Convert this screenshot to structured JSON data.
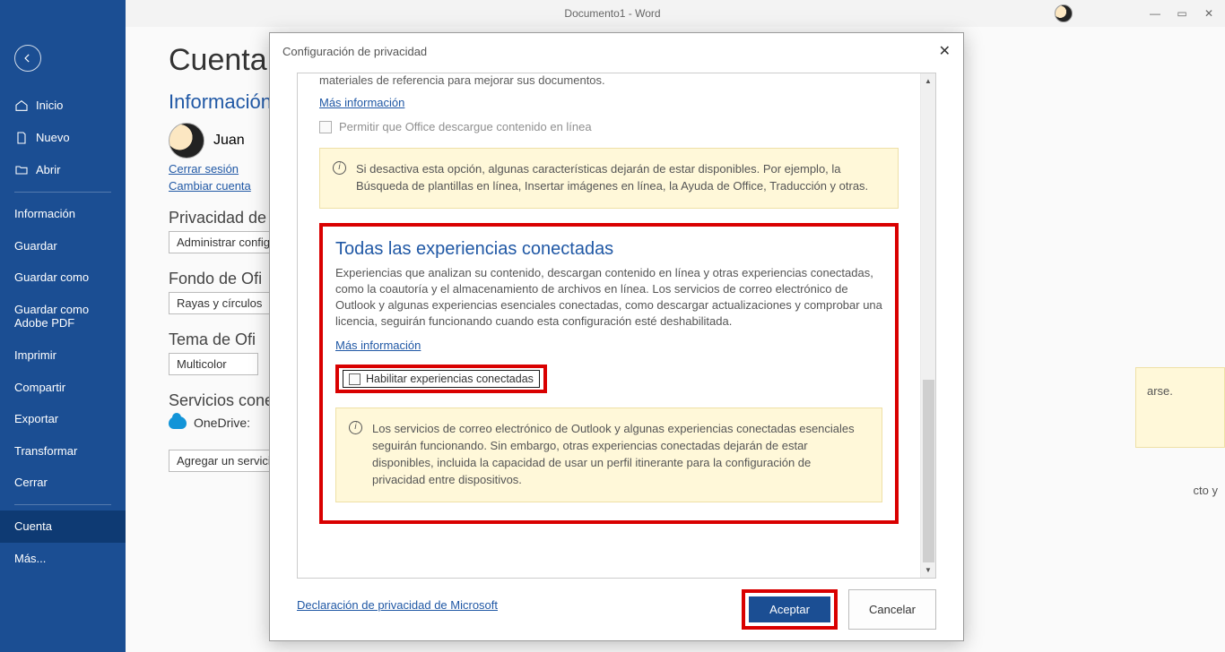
{
  "title": "Documento1  -  Word",
  "windowControls": {
    "minimize": "—",
    "maximize": "▭",
    "close": "✕"
  },
  "sidebar": {
    "items": [
      {
        "label": "Inicio",
        "icon": "home"
      },
      {
        "label": "Nuevo",
        "icon": "new-doc"
      },
      {
        "label": "Abrir",
        "icon": "open"
      },
      {
        "label": "Información"
      },
      {
        "label": "Guardar"
      },
      {
        "label": "Guardar como"
      },
      {
        "label": "Guardar como Adobe PDF"
      },
      {
        "label": "Imprimir"
      },
      {
        "label": "Compartir"
      },
      {
        "label": "Exportar"
      },
      {
        "label": "Transformar"
      },
      {
        "label": "Cerrar"
      },
      {
        "label": "Cuenta"
      },
      {
        "label": "Más..."
      }
    ]
  },
  "main": {
    "pageTitle": "Cuenta",
    "sectionUser": "Información",
    "userName": "Juan",
    "linkSignOut": "Cerrar sesión",
    "linkSwitch": "Cambiar cuenta",
    "sectionPrivacy": "Privacidad de",
    "managePrivacy": "Administrar config",
    "sectionBg": "Fondo de Ofi",
    "bgValue": "Rayas y círculos",
    "sectionTheme": "Tema de Ofi",
    "themeValue": "Multicolor",
    "sectionServices": "Servicios conectados",
    "onedrive": "OneDrive:",
    "addService": "Agregar un servicio",
    "sideNoteLine1": "arse.",
    "sideNoteLine2": "cto y"
  },
  "dialog": {
    "title": "Configuración de privacidad",
    "partialIntro": "materiales de referencia para mejorar sus documentos.",
    "moreInfo": "Más información",
    "allowDownload": "Permitir que Office descargue contenido en línea",
    "warn1": "Si desactiva esta opción, algunas características dejarán de estar disponibles. Por ejemplo, la Búsqueda de plantillas en línea, Insertar imágenes en línea, la Ayuda de Office, Traducción y otras.",
    "sectionTitle": "Todas las experiencias conectadas",
    "sectionPara": "Experiencias que analizan su contenido, descargan contenido en línea y otras experiencias conectadas, como la coautoría y el almacenamiento de archivos en línea. Los servicios de correo electrónico de Outlook y algunas experiencias esenciales conectadas, como descargar actualizaciones y comprobar una licencia, seguirán funcionando cuando esta configuración esté deshabilitada.",
    "moreInfo2": "Más información",
    "enableConnected": "Habilitar experiencias conectadas",
    "warn2": "Los servicios de correo electrónico de Outlook y algunas experiencias conectadas esenciales seguirán funcionando. Sin embargo, otras experiencias conectadas dejarán de estar disponibles, incluida la capacidad de usar un perfil itinerante para la configuración de privacidad entre dispositivos.",
    "privacyLink": "Declaración de privacidad de Microsoft",
    "accept": "Aceptar",
    "cancel": "Cancelar"
  }
}
